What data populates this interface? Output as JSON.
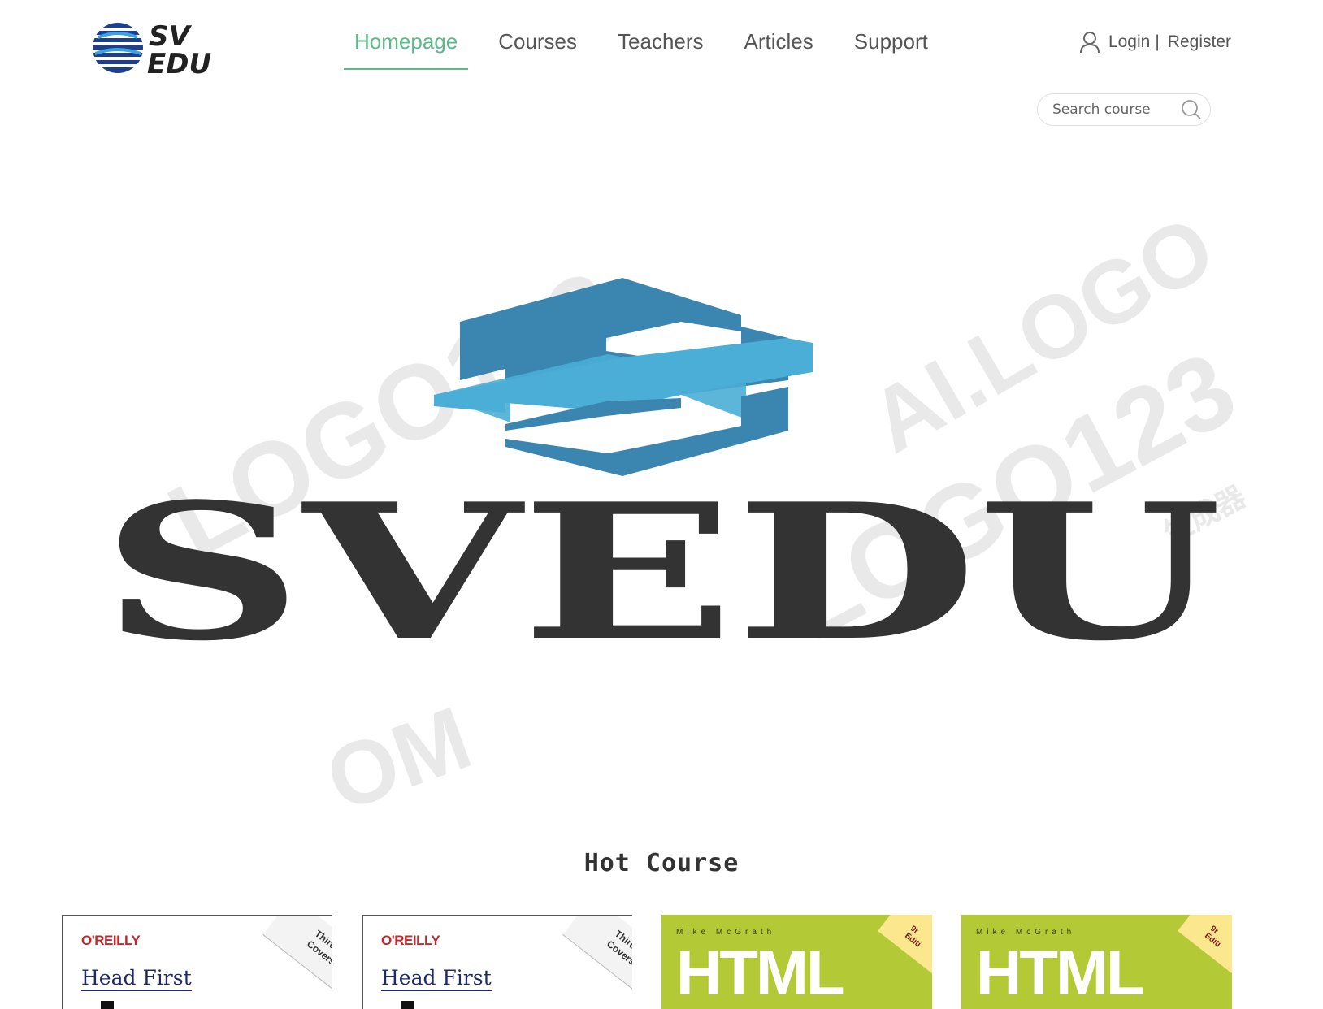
{
  "header": {
    "logo": {
      "line1": "SV",
      "line2": "EDU"
    },
    "nav": [
      {
        "label": "Homepage",
        "active": true
      },
      {
        "label": "Courses",
        "active": false
      },
      {
        "label": "Teachers",
        "active": false
      },
      {
        "label": "Articles",
        "active": false
      },
      {
        "label": "Support",
        "active": false
      }
    ],
    "auth": {
      "login": "Login",
      "separator": "|",
      "register": "Register",
      "icon": "user-icon"
    },
    "search": {
      "placeholder": "Search course",
      "value": "",
      "icon": "search-icon"
    }
  },
  "banner": {
    "brand": "SVEDU",
    "watermarks": [
      "LOGO123",
      "AI.LOGO",
      "生成器",
      "OM"
    ]
  },
  "hot_course": {
    "title": "Hot Course",
    "courses": [
      {
        "publisher": "O'REILLY",
        "title": "Head First",
        "corner": "Third E\nCovers Jav"
      },
      {
        "publisher": "O'REILLY",
        "title": "Head First",
        "corner": "Third E\nCovers Jav"
      },
      {
        "author": "Mike McGrath",
        "title": "HTML",
        "corner": "9t\nEditi"
      },
      {
        "author": "Mike McGrath",
        "title": "HTML",
        "corner": "9t\nEditi"
      }
    ]
  },
  "colors": {
    "accent": "#5cb98a",
    "brand_dark": "#333333",
    "brand_blue": "#3a86b0",
    "brand_light_blue": "#4aaed6",
    "html_book_green": "#b3c935"
  }
}
